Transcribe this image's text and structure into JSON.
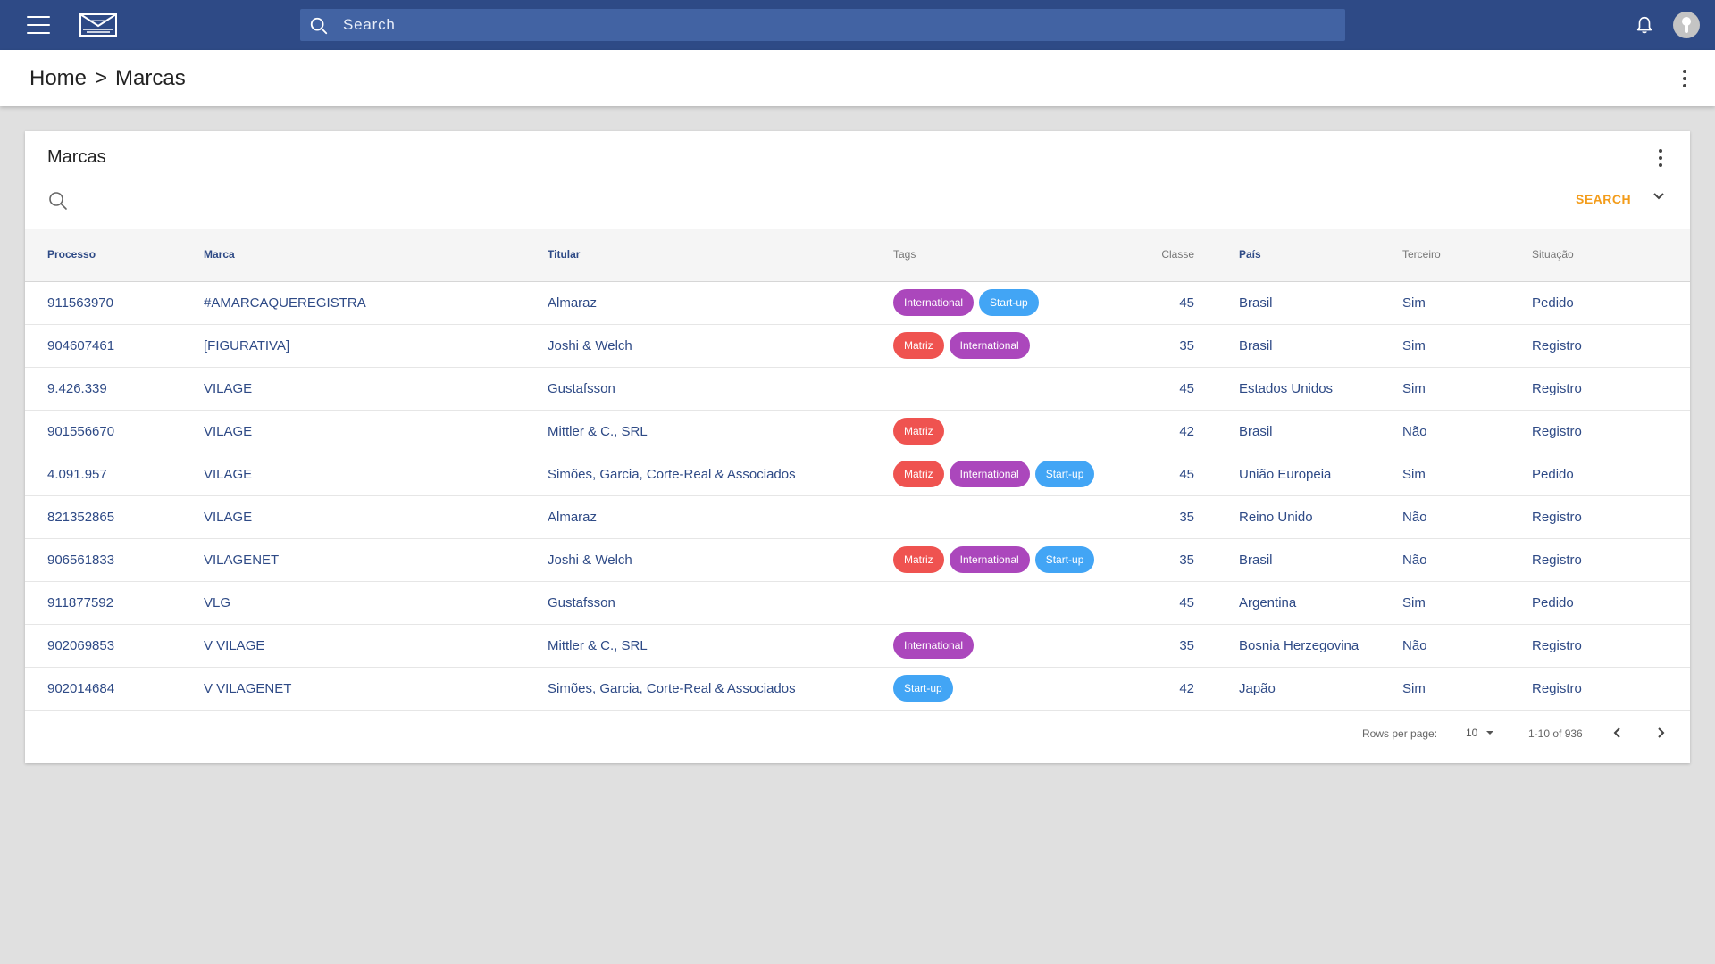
{
  "appbar": {
    "search_placeholder": "Search",
    "bg_color": "#2e4a86"
  },
  "breadcrumb": {
    "home": "Home",
    "separator": ">",
    "current": "Marcas"
  },
  "card": {
    "title": "Marcas",
    "search_action": "SEARCH"
  },
  "table": {
    "headers": {
      "processo": "Processo",
      "marca": "Marca",
      "titular": "Titular",
      "tags": "Tags",
      "classe": "Classe",
      "pais": "País",
      "terceiro": "Terceiro",
      "situacao": "Situação"
    },
    "rows": [
      {
        "processo": "911563970",
        "marca": "#AMARCAQUEREGISTRA",
        "titular": "Almaraz",
        "tags": [
          "International",
          "Start-up"
        ],
        "classe": "45",
        "pais": "Brasil",
        "terceiro": "Sim",
        "situacao": "Pedido"
      },
      {
        "processo": "904607461",
        "marca": "[FIGURATIVA]",
        "titular": "Joshi & Welch",
        "tags": [
          "Matriz",
          "International"
        ],
        "classe": "35",
        "pais": "Brasil",
        "terceiro": "Sim",
        "situacao": "Registro"
      },
      {
        "processo": "9.426.339",
        "marca": "VILAGE",
        "titular": "Gustafsson",
        "tags": [],
        "classe": "45",
        "pais": "Estados Unidos",
        "terceiro": "Sim",
        "situacao": "Registro"
      },
      {
        "processo": "901556670",
        "marca": "VILAGE",
        "titular": "Mittler & C., SRL",
        "tags": [
          "Matriz"
        ],
        "classe": "42",
        "pais": "Brasil",
        "terceiro": "Não",
        "situacao": "Registro"
      },
      {
        "processo": "4.091.957",
        "marca": "VILAGE",
        "titular": "Simões, Garcia, Corte-Real & Associados",
        "tags": [
          "Matriz",
          "International",
          "Start-up"
        ],
        "classe": "45",
        "pais": "União Europeia",
        "terceiro": "Sim",
        "situacao": "Pedido"
      },
      {
        "processo": "821352865",
        "marca": "VILAGE",
        "titular": "Almaraz",
        "tags": [],
        "classe": "35",
        "pais": "Reino Unido",
        "terceiro": "Não",
        "situacao": "Registro"
      },
      {
        "processo": "906561833",
        "marca": "VILAGENET",
        "titular": "Joshi & Welch",
        "tags": [
          "Matriz",
          "International",
          "Start-up"
        ],
        "classe": "35",
        "pais": "Brasil",
        "terceiro": "Não",
        "situacao": "Registro"
      },
      {
        "processo": "911877592",
        "marca": "VLG",
        "titular": "Gustafsson",
        "tags": [],
        "classe": "45",
        "pais": "Argentina",
        "terceiro": "Sim",
        "situacao": "Pedido"
      },
      {
        "processo": "902069853",
        "marca": "V VILAGE",
        "titular": "Mittler & C., SRL",
        "tags": [
          "International"
        ],
        "classe": "35",
        "pais": "Bosnia Herzegovina",
        "terceiro": "Não",
        "situacao": "Registro"
      },
      {
        "processo": "902014684",
        "marca": "V VILAGENET",
        "titular": "Simões, Garcia, Corte-Real & Associados",
        "tags": [
          "Start-up"
        ],
        "classe": "42",
        "pais": "Japão",
        "terceiro": "Sim",
        "situacao": "Registro"
      }
    ]
  },
  "tag_colors": {
    "International": "#ab47bc",
    "Start-up": "#42a5f5",
    "Matriz": "#ef5350"
  },
  "pagination": {
    "rows_per_page_label": "Rows per page:",
    "rows_per_page_value": "10",
    "range": "1-10 of 936"
  }
}
